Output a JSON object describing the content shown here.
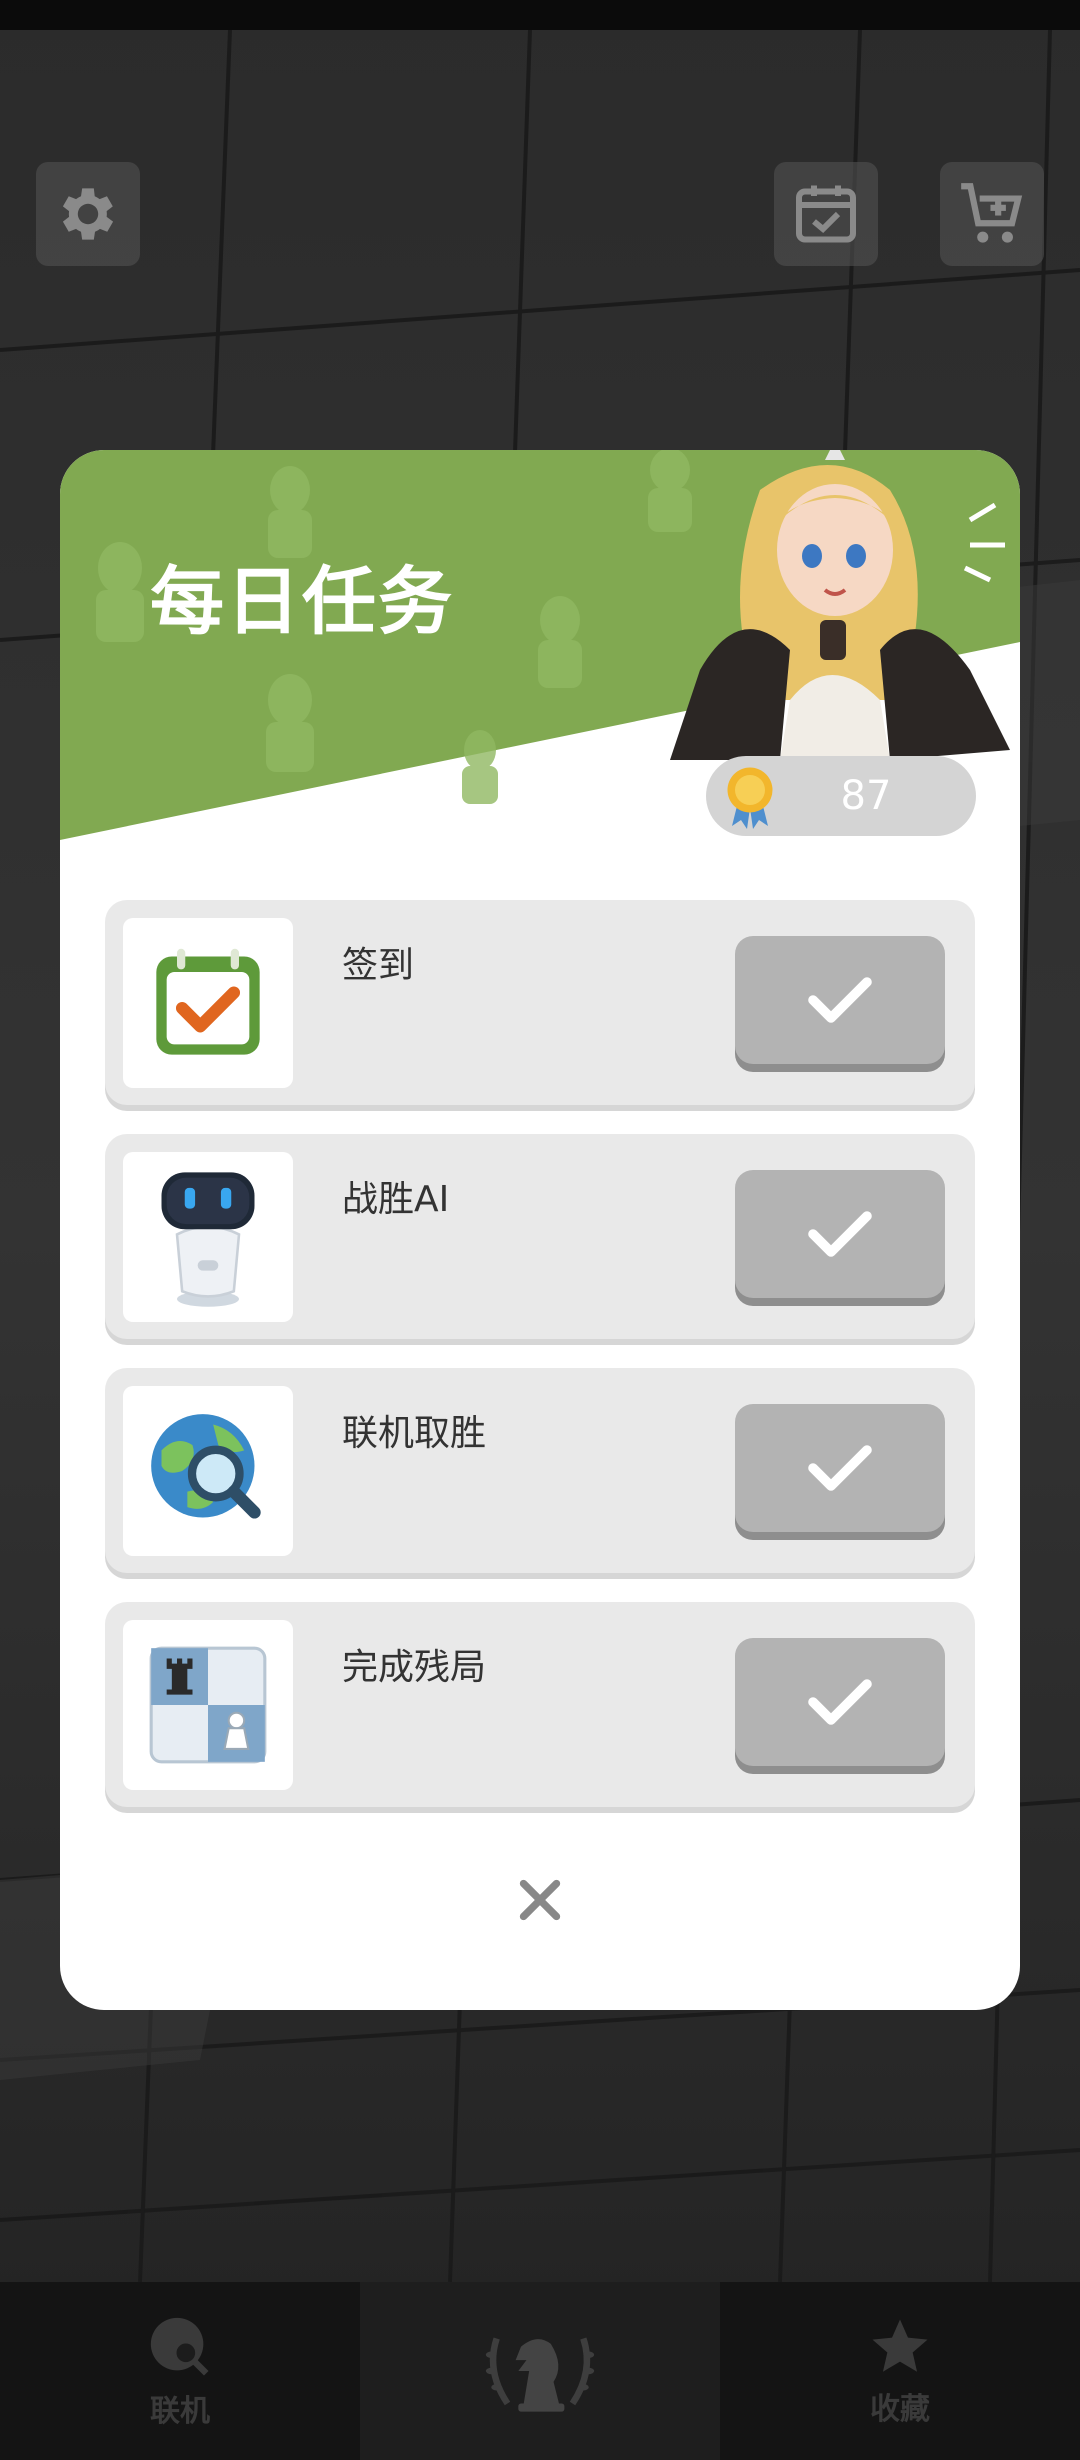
{
  "dialog": {
    "title": "每日任务",
    "coins": "87",
    "tasks": [
      {
        "label": "签到",
        "icon": "calendar-check-icon"
      },
      {
        "label": "战胜AI",
        "icon": "robot-icon"
      },
      {
        "label": "联机取胜",
        "icon": "globe-search-icon"
      },
      {
        "label": "完成残局",
        "icon": "chessboard-icon"
      }
    ],
    "close_icon": "close-icon"
  },
  "top_bar": {
    "settings_icon": "gear-icon",
    "calendar_icon": "calendar-icon",
    "shop_icon": "cart-plus-icon"
  },
  "bottom_nav": {
    "items": [
      {
        "label": "联机",
        "icon": "globe-search-icon"
      },
      {
        "label": "",
        "icon": "knight-laurel-icon"
      },
      {
        "label": "收藏",
        "icon": "star-icon"
      }
    ]
  },
  "colors": {
    "header_green": "#81a951",
    "check_button": "#b3b3b3",
    "row_bg": "#e9e9e9"
  }
}
